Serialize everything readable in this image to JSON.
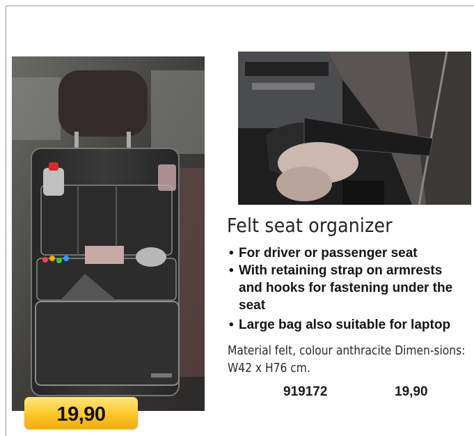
{
  "product": {
    "title": "Felt seat organizer",
    "features": [
      "For driver or passenger seat",
      "With retaining strap on armrests and hooks for fastening under the seat",
      "Large bag also suitable for laptop"
    ],
    "description": "Material felt, colour anthracite Dimen-sions: W42 x H76 cm.",
    "article_number": "919172",
    "price": "19,90",
    "badge_price": "19,90"
  },
  "images": {
    "main": "seat-organizer-on-car-seat-photo",
    "detail": "armrest-retaining-strap-photo"
  },
  "colors": {
    "badge": "#fcc72a",
    "felt": "#2e2e2e"
  }
}
